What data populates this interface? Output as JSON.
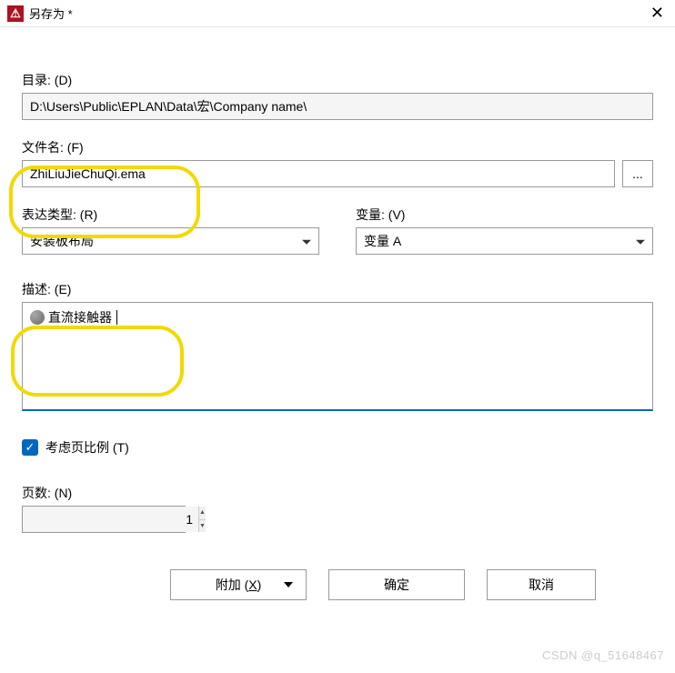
{
  "window": {
    "title": "另存为 *"
  },
  "directory": {
    "label": "目录: (D)",
    "value": "D:\\Users\\Public\\EPLAN\\Data\\宏\\Company name\\"
  },
  "filename": {
    "label": "文件名: (F)",
    "value": "ZhiLiuJieChuQi.ema",
    "browse": "..."
  },
  "express_type": {
    "label": "表达类型: (R)",
    "value": "安装板布局"
  },
  "variable": {
    "label": "变量: (V)",
    "value": "变量 A"
  },
  "description": {
    "label": "描述: (E)",
    "value": "直流接触器"
  },
  "consider_scale": {
    "label": "考虑页比例 (T)",
    "checked": true
  },
  "pages": {
    "label": "页数: (N)",
    "value": "1"
  },
  "buttons": {
    "add_prefix": "附加 (",
    "add_key": "X",
    "add_suffix": ")",
    "ok": "确定",
    "cancel": "取消"
  },
  "watermark": "CSDN @q_51648467"
}
